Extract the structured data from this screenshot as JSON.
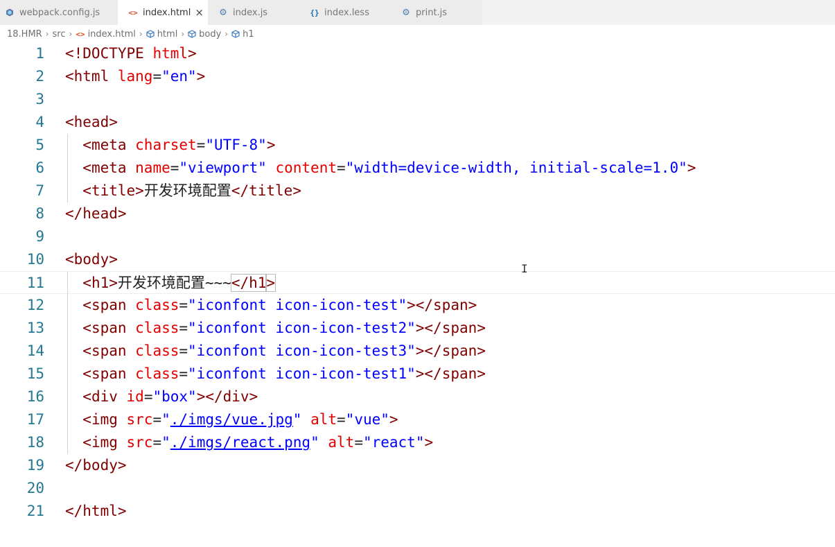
{
  "tabs": [
    {
      "label": "webpack.config.js",
      "icon": "webpack-icon",
      "active": false
    },
    {
      "label": "index.html",
      "icon": "html-tag-icon",
      "active": true
    },
    {
      "label": "index.js",
      "icon": "gear-icon",
      "active": false
    },
    {
      "label": "index.less",
      "icon": "braces-icon",
      "active": false
    },
    {
      "label": "print.js",
      "icon": "gear-icon",
      "active": false
    }
  ],
  "breadcrumb": [
    {
      "label": "18.HMR",
      "icon": ""
    },
    {
      "label": "src",
      "icon": ""
    },
    {
      "label": "index.html",
      "icon": "html-tag-icon"
    },
    {
      "label": "html",
      "icon": "cube-icon"
    },
    {
      "label": "body",
      "icon": "cube-icon"
    },
    {
      "label": "h1",
      "icon": "cube-icon"
    }
  ],
  "editor": {
    "current_line": 11,
    "lines": [
      {
        "n": "1",
        "segs": [
          [
            "tag",
            "<!DOCTYPE "
          ],
          [
            "attr",
            "html"
          ],
          [
            "tag",
            ">"
          ]
        ]
      },
      {
        "n": "2",
        "segs": [
          [
            "tag",
            "<html "
          ],
          [
            "attr",
            "lang"
          ],
          [
            "txt",
            "="
          ],
          [
            "str",
            "\"en\""
          ],
          [
            "tag",
            ">"
          ]
        ]
      },
      {
        "n": "3",
        "segs": []
      },
      {
        "n": "4",
        "segs": [
          [
            "tag",
            "<head>"
          ]
        ]
      },
      {
        "n": "5",
        "segs": [
          [
            "txt",
            "  "
          ],
          [
            "tag",
            "<meta "
          ],
          [
            "attr",
            "charset"
          ],
          [
            "txt",
            "="
          ],
          [
            "str",
            "\"UTF-8\""
          ],
          [
            "tag",
            ">"
          ]
        ]
      },
      {
        "n": "6",
        "segs": [
          [
            "txt",
            "  "
          ],
          [
            "tag",
            "<meta "
          ],
          [
            "attr",
            "name"
          ],
          [
            "txt",
            "="
          ],
          [
            "str",
            "\"viewport\""
          ],
          [
            "txt",
            " "
          ],
          [
            "attr",
            "content"
          ],
          [
            "txt",
            "="
          ],
          [
            "str",
            "\"width=device-width, initial-scale=1.0\""
          ],
          [
            "tag",
            ">"
          ]
        ]
      },
      {
        "n": "7",
        "segs": [
          [
            "txt",
            "  "
          ],
          [
            "tag",
            "<title>"
          ],
          [
            "txt",
            "开发环境配置"
          ],
          [
            "tag",
            "</title>"
          ]
        ]
      },
      {
        "n": "8",
        "segs": [
          [
            "tag",
            "</head>"
          ]
        ]
      },
      {
        "n": "9",
        "segs": []
      },
      {
        "n": "10",
        "segs": [
          [
            "tag",
            "<body>"
          ]
        ]
      },
      {
        "n": "11",
        "segs": [
          [
            "txt",
            "  "
          ],
          [
            "tag",
            "<h1>"
          ],
          [
            "txt",
            "开发环境配置~~~"
          ],
          [
            "tag",
            "</h1"
          ],
          [
            "tag",
            ">"
          ]
        ]
      },
      {
        "n": "12",
        "segs": [
          [
            "txt",
            "  "
          ],
          [
            "tag",
            "<span "
          ],
          [
            "attr",
            "class"
          ],
          [
            "txt",
            "="
          ],
          [
            "str",
            "\"iconfont icon-icon-test\""
          ],
          [
            "tag",
            "></span>"
          ]
        ]
      },
      {
        "n": "13",
        "segs": [
          [
            "txt",
            "  "
          ],
          [
            "tag",
            "<span "
          ],
          [
            "attr",
            "class"
          ],
          [
            "txt",
            "="
          ],
          [
            "str",
            "\"iconfont icon-icon-test2\""
          ],
          [
            "tag",
            "></span>"
          ]
        ]
      },
      {
        "n": "14",
        "segs": [
          [
            "txt",
            "  "
          ],
          [
            "tag",
            "<span "
          ],
          [
            "attr",
            "class"
          ],
          [
            "txt",
            "="
          ],
          [
            "str",
            "\"iconfont icon-icon-test3\""
          ],
          [
            "tag",
            "></span>"
          ]
        ]
      },
      {
        "n": "15",
        "segs": [
          [
            "txt",
            "  "
          ],
          [
            "tag",
            "<span "
          ],
          [
            "attr",
            "class"
          ],
          [
            "txt",
            "="
          ],
          [
            "str",
            "\"iconfont icon-icon-test1\""
          ],
          [
            "tag",
            "></span>"
          ]
        ]
      },
      {
        "n": "16",
        "segs": [
          [
            "txt",
            "  "
          ],
          [
            "tag",
            "<div "
          ],
          [
            "attr",
            "id"
          ],
          [
            "txt",
            "="
          ],
          [
            "str",
            "\"box\""
          ],
          [
            "tag",
            "></div>"
          ]
        ]
      },
      {
        "n": "17",
        "segs": [
          [
            "txt",
            "  "
          ],
          [
            "tag",
            "<img "
          ],
          [
            "attr",
            "src"
          ],
          [
            "txt",
            "="
          ],
          [
            "str",
            "\""
          ],
          [
            "link",
            "./imgs/vue.jpg"
          ],
          [
            "str",
            "\""
          ],
          [
            "txt",
            " "
          ],
          [
            "attr",
            "alt"
          ],
          [
            "txt",
            "="
          ],
          [
            "str",
            "\"vue\""
          ],
          [
            "tag",
            ">"
          ]
        ]
      },
      {
        "n": "18",
        "segs": [
          [
            "txt",
            "  "
          ],
          [
            "tag",
            "<img "
          ],
          [
            "attr",
            "src"
          ],
          [
            "txt",
            "="
          ],
          [
            "str",
            "\""
          ],
          [
            "link",
            "./imgs/react.png"
          ],
          [
            "str",
            "\""
          ],
          [
            "txt",
            " "
          ],
          [
            "attr",
            "alt"
          ],
          [
            "txt",
            "="
          ],
          [
            "str",
            "\"react\""
          ],
          [
            "tag",
            ">"
          ]
        ]
      },
      {
        "n": "19",
        "segs": [
          [
            "tag",
            "</body>"
          ]
        ]
      },
      {
        "n": "20",
        "segs": []
      },
      {
        "n": "21",
        "segs": [
          [
            "tag",
            "</html>"
          ]
        ]
      }
    ]
  },
  "colors": {
    "line_number": "#237893",
    "tag": "#800000",
    "attribute": "#e50000",
    "string": "#0000ff"
  }
}
